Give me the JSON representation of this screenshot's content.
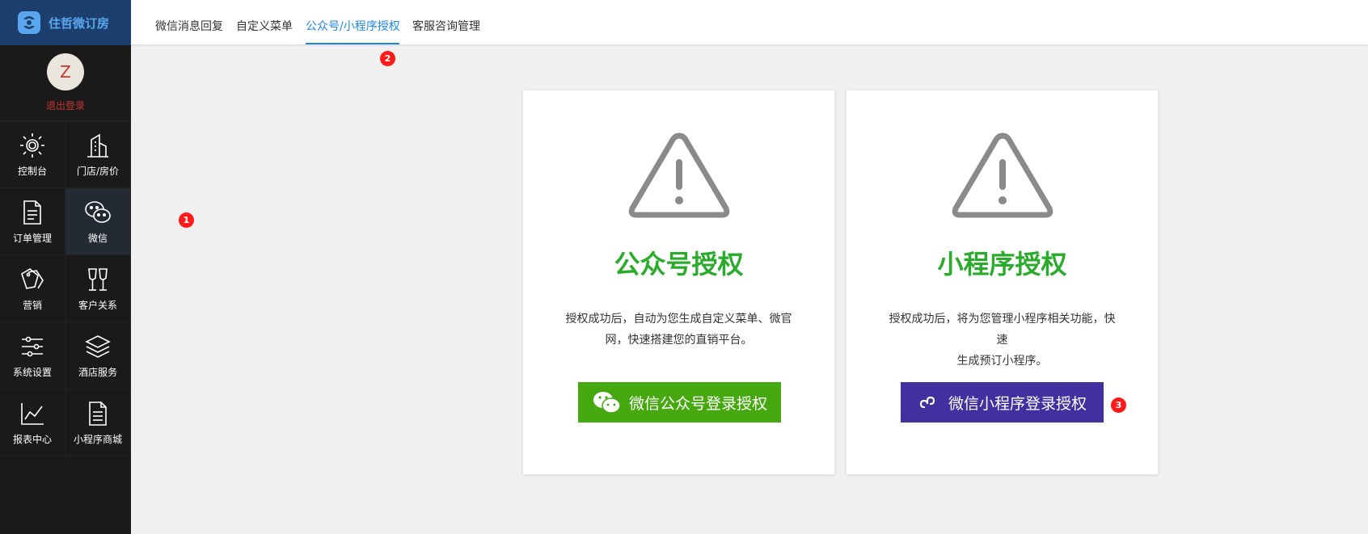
{
  "brand": {
    "name": "住哲微订房"
  },
  "user": {
    "avatar_letter": "Z",
    "logout_label": "退出登录"
  },
  "nav": {
    "dashboard": "控制台",
    "store_price": "门店/房价",
    "orders": "订单管理",
    "wechat": "微信",
    "marketing": "营销",
    "customers": "客户关系",
    "settings": "系统设置",
    "hotel_service": "酒店服务",
    "reports": "报表中心",
    "mini_mall": "小程序商城"
  },
  "tabs": {
    "message_reply": "微信消息回复",
    "custom_menu": "自定义菜单",
    "authorization": "公众号/小程序授权",
    "customer_service": "客服咨询管理"
  },
  "badges": {
    "b1": "1",
    "b2": "2",
    "b3": "3"
  },
  "cards": {
    "official": {
      "title": "公众号授权",
      "desc_line1": "授权成功后，自动为您生成自定义菜单、微官",
      "desc_line2": "网，快速搭建您的直销平台。",
      "button": "微信公众号登录授权"
    },
    "mini": {
      "title": "小程序授权",
      "desc_line1": "授权成功后，将为您管理小程序相关功能，快速",
      "desc_line2": "生成预订小程序。",
      "button": "微信小程序登录授权"
    }
  },
  "colors": {
    "accent": "#1e88e5",
    "green": "#46a80f",
    "purple": "#4330a0",
    "title_green": "#2bab2b",
    "badge_red": "#ff1a1a"
  }
}
